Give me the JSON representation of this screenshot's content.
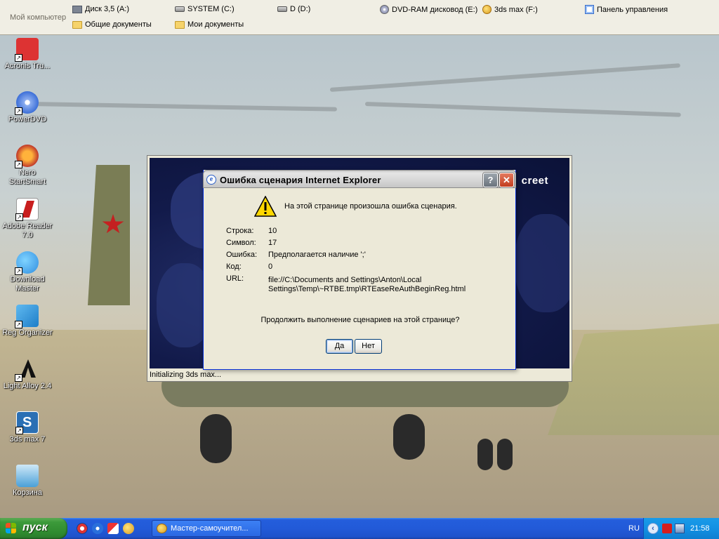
{
  "drivebar": {
    "title": "Мой компьютер",
    "items": [
      {
        "label": "Диск 3,5 (A:)",
        "icon": "floppy-icon"
      },
      {
        "label": "SYSTEM (C:)",
        "icon": "hard-drive-icon"
      },
      {
        "label": "D (D:)",
        "icon": "hard-drive-icon"
      },
      {
        "label": "DVD-RAM дисковод (E:)",
        "icon": "dvd-drive-icon"
      },
      {
        "label": "3ds max (F:)",
        "icon": "3dsmax-drive-icon"
      },
      {
        "label": "Панель управления",
        "icon": "control-panel-icon"
      },
      {
        "label": "Общие документы",
        "icon": "folder-icon"
      },
      {
        "label": "Мои документы",
        "icon": "folder-icon"
      }
    ]
  },
  "desktop_icons": [
    {
      "label": "Acronis Tru...",
      "color": "#d33"
    },
    {
      "label": "PowerDVD",
      "color": "#3c6fd8"
    },
    {
      "label": "Nero StartSmart",
      "color": "#c0392b"
    },
    {
      "label": "Adobe Reader 7.0",
      "color": "#c81e1e"
    },
    {
      "label": "Download Master",
      "color": "#2f8de0"
    },
    {
      "label": "Reg Organizer",
      "color": "#1e7ec8"
    },
    {
      "label": "Light Alloy 2.4",
      "color": "#222"
    },
    {
      "label": "3ds max 7",
      "color": "#2a6fb4"
    },
    {
      "label": "Корзина",
      "color": "#4aa0d8"
    }
  ],
  "installer": {
    "logo": "creet",
    "status": "Initializing 3ds max..."
  },
  "dialog": {
    "title": "Ошибка сценария Internet Explorer",
    "help_label": "?",
    "close_label": "✕",
    "message": "На этой странице произошла ошибка сценария.",
    "fields": [
      {
        "key": "Строка:",
        "value": "10"
      },
      {
        "key": "Символ:",
        "value": "17"
      },
      {
        "key": "Ошибка:",
        "value": "Предполагается наличие ';'"
      },
      {
        "key": "Код:",
        "value": "0"
      },
      {
        "key": "URL:",
        "value": "file://C:\\Documents and Settings\\Anton\\Local",
        "value2": "Settings\\Temp\\~RTBE.tmp\\RTEaseReAuthBeginReg.html"
      }
    ],
    "question": "Продолжить выполнение сценариев на этой странице?",
    "yes_label": "Да",
    "no_label": "Нет"
  },
  "taskbar": {
    "start_label": "пуск",
    "task_label": "Мастер-самоучител...",
    "lang": "RU",
    "clock": "21:58"
  },
  "colors": {
    "taskbar_blue": "#245edc",
    "start_green": "#3c9a3a",
    "tray_blue": "#1290e3",
    "dialog_face": "#ece9d8"
  }
}
